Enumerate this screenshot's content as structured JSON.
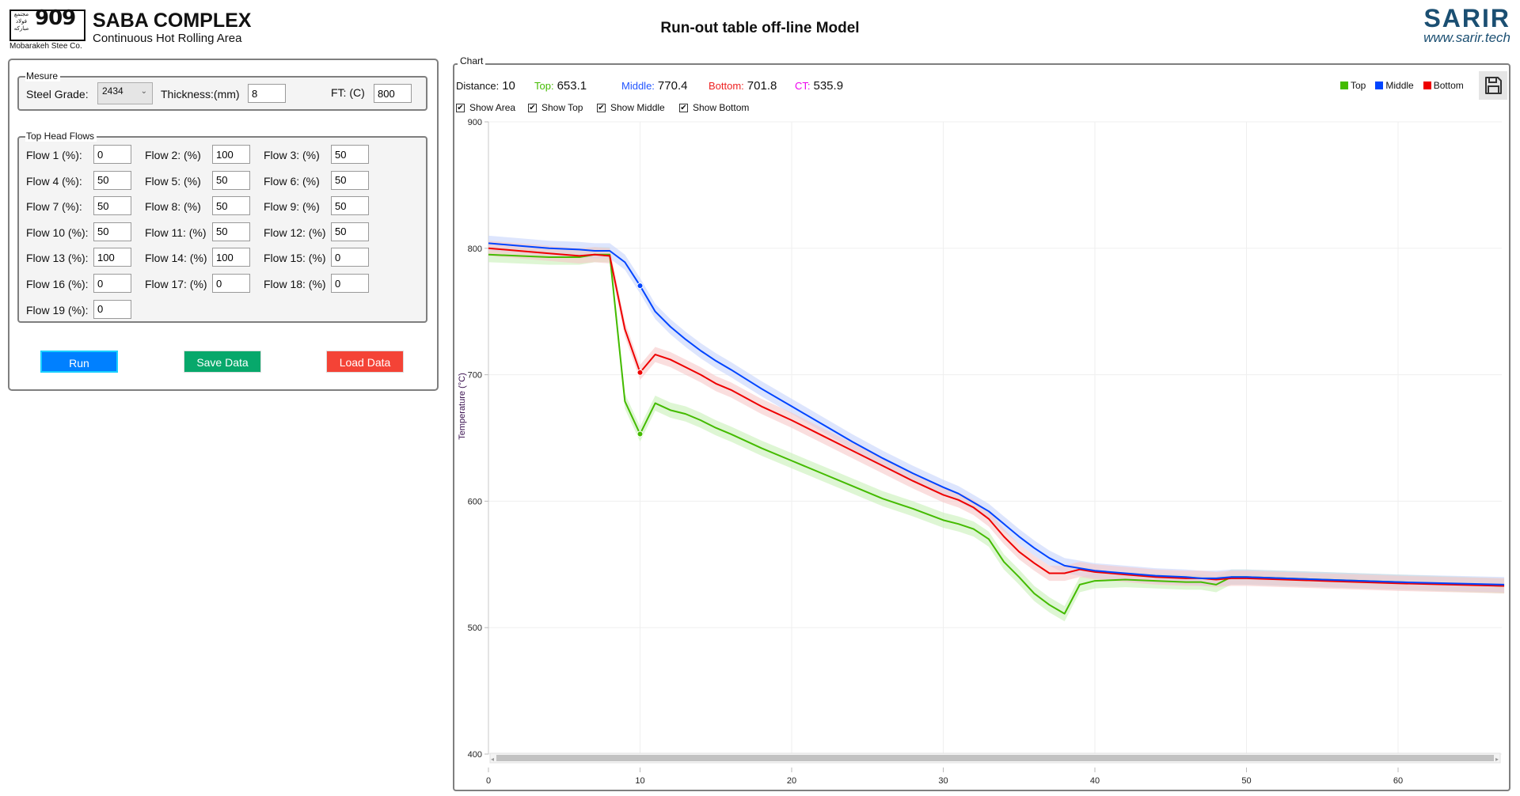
{
  "header": {
    "logo_mark": "909",
    "logo_persian": "مجتمع فولاد مبارکه",
    "logo_caption": "Mobarakeh Stee Co.",
    "brand_title": "SABA COMPLEX",
    "brand_subtitle": "Continuous Hot Rolling Area",
    "page_title": "Run-out table off-line Model",
    "vendor_name": "SARIR",
    "vendor_url": "www.sarir.tech"
  },
  "measure": {
    "group_label": "Mesure",
    "steel_grade_label": "Steel Grade:",
    "steel_grade_value": "2434",
    "thickness_label": "Thickness:(mm)",
    "thickness_value": "8",
    "ft_label": "FT: (C)",
    "ft_value": "800"
  },
  "flows": {
    "group_label": "Top Head Flows",
    "items": [
      {
        "label": "Flow 1 (%):",
        "value": "0"
      },
      {
        "label": "Flow 2: (%)",
        "value": "100"
      },
      {
        "label": "Flow 3: (%)",
        "value": "50"
      },
      {
        "label": "Flow 4 (%):",
        "value": "50"
      },
      {
        "label": "Flow 5: (%)",
        "value": "50"
      },
      {
        "label": "Flow 6: (%)",
        "value": "50"
      },
      {
        "label": "Flow 7 (%):",
        "value": "50"
      },
      {
        "label": "Flow 8: (%)",
        "value": "50"
      },
      {
        "label": "Flow 9: (%)",
        "value": "50"
      },
      {
        "label": "Flow 10 (%):",
        "value": "50"
      },
      {
        "label": "Flow 11: (%)",
        "value": "50"
      },
      {
        "label": "Flow 12: (%)",
        "value": "50"
      },
      {
        "label": "Flow 13 (%):",
        "value": "100"
      },
      {
        "label": "Flow 14: (%)",
        "value": "100"
      },
      {
        "label": "Flow 15: (%)",
        "value": "0"
      },
      {
        "label": "Flow 16 (%):",
        "value": "0"
      },
      {
        "label": "Flow 17: (%)",
        "value": "0"
      },
      {
        "label": "Flow 18: (%)",
        "value": "0"
      },
      {
        "label": "Flow 19 (%):",
        "value": "0"
      }
    ]
  },
  "actions": {
    "run_label": "Run",
    "save_label": "Save Data",
    "load_label": "Load Data",
    "run_color": "#0080ff",
    "save_color": "#07a86b",
    "load_color": "#f44336"
  },
  "chart_panel": {
    "group_label": "Chart",
    "readout": {
      "distance_label": "Distance:",
      "distance_value": "10",
      "top_label": "Top:",
      "top_value": "653.1",
      "middle_label": "Middle:",
      "middle_value": "770.4",
      "bottom_label": "Bottom:",
      "bottom_value": "701.8",
      "ct_label": "CT:",
      "ct_value": "535.9"
    },
    "checkboxes": [
      {
        "label": "Show Area",
        "checked": true
      },
      {
        "label": "Show Top",
        "checked": true
      },
      {
        "label": "Show Middle",
        "checked": true
      },
      {
        "label": "Show Bottom",
        "checked": true
      }
    ],
    "save_icon": "floppy-disk-icon"
  },
  "chart_data": {
    "type": "line",
    "title": "",
    "xlabel": "",
    "ylabel": "Temperature (°C)",
    "xlim": [
      0,
      67
    ],
    "ylim": [
      400,
      900
    ],
    "xticks": [
      0,
      10,
      20,
      30,
      40,
      50,
      60
    ],
    "yticks": [
      400,
      500,
      600,
      700,
      800,
      900
    ],
    "grid": true,
    "legend_position": "top-right",
    "show_area": true,
    "area_halfwidth": 6,
    "highlight_x": 10,
    "x": [
      0,
      2,
      4,
      6,
      7,
      8,
      9,
      10,
      11,
      12,
      13,
      14,
      15,
      16,
      18,
      20,
      22,
      24,
      26,
      28,
      30,
      31,
      32,
      33,
      34,
      35,
      36,
      37,
      38,
      39,
      40,
      42,
      44,
      46,
      47,
      48,
      49,
      50,
      55,
      60,
      67
    ],
    "series": [
      {
        "name": "Top",
        "color": "#44bb00",
        "area_color": "#c8f0b8",
        "values": [
          795,
          794,
          793,
          793,
          795,
          795,
          679,
          653.1,
          677.5,
          672,
          669,
          664,
          658,
          653,
          642,
          632,
          622,
          612,
          602,
          594,
          585,
          582,
          578,
          570,
          552,
          540,
          527,
          518,
          511,
          534,
          537,
          538,
          537,
          536,
          536,
          534,
          540,
          540,
          538,
          536,
          533
        ]
      },
      {
        "name": "Middle",
        "color": "#0044ff",
        "area_color": "#c6d3fb",
        "values": [
          804,
          802,
          800,
          799,
          798,
          798,
          789,
          770.4,
          750,
          738,
          728,
          719,
          711,
          704,
          689,
          675,
          661,
          647,
          634,
          622,
          611,
          606,
          599,
          592,
          582,
          572,
          563,
          555,
          549,
          547,
          545,
          543,
          541,
          540,
          539,
          539,
          540,
          540,
          538,
          536,
          534
        ]
      },
      {
        "name": "Bottom",
        "color": "#ee0000",
        "area_color": "#f7c8c8",
        "values": [
          800,
          798,
          796,
          794,
          795,
          794,
          736,
          701.8,
          716,
          712,
          706,
          700,
          693,
          688,
          675,
          664,
          652,
          640,
          628,
          616,
          605,
          601,
          595,
          586,
          572,
          560,
          551,
          543,
          543,
          546,
          544,
          542,
          540,
          539,
          539,
          538,
          539,
          539,
          537,
          535,
          533
        ]
      }
    ]
  }
}
